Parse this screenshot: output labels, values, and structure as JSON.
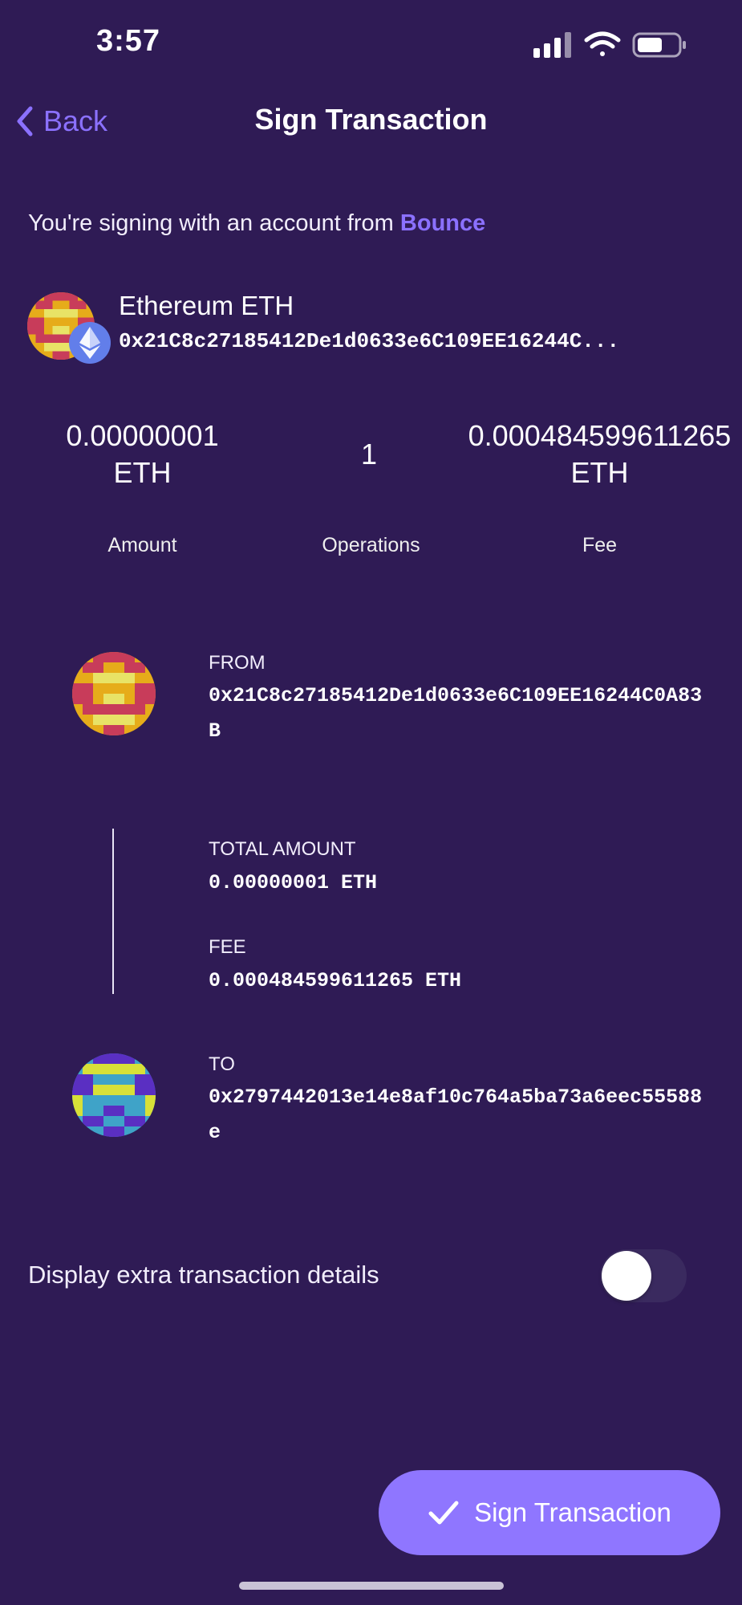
{
  "status_bar": {
    "time": "3:57",
    "icons": [
      "signal-icon",
      "wifi-icon",
      "battery-icon"
    ]
  },
  "nav": {
    "back_label": "Back",
    "title": "Sign Transaction"
  },
  "signing": {
    "prefix": "You're signing with an account from ",
    "brand": "Bounce"
  },
  "account": {
    "name": "Ethereum",
    "symbol": "ETH",
    "address": "0x21C8c27185412De1d0633e6C109EE16244C..."
  },
  "stats": {
    "amount_value": "0.00000001",
    "amount_unit": "ETH",
    "amount_label": "Amount",
    "operations_value": "1",
    "operations_label": "Operations",
    "fee_value": "0.000484599611265",
    "fee_unit": "ETH",
    "fee_label": "Fee"
  },
  "flow": {
    "from_label": "FROM",
    "from_address": "0x21C8c27185412De1d0633e6C109EE16244C0A83B",
    "total_label": "TOTAL AMOUNT",
    "total_value": "0.00000001 ETH",
    "fee_label": "FEE",
    "fee_value": "0.000484599611265 ETH",
    "to_label": "TO",
    "to_address": "0x2797442013e14e8af10c764a5ba73a6eec55588e"
  },
  "extra": {
    "label": "Display extra transaction details",
    "enabled": false
  },
  "sign_button": {
    "label": "Sign Transaction"
  },
  "colors": {
    "background": "#2f1b55",
    "accent": "#8b71ff",
    "button": "#8f76ff",
    "eth_badge": "#627eea"
  }
}
